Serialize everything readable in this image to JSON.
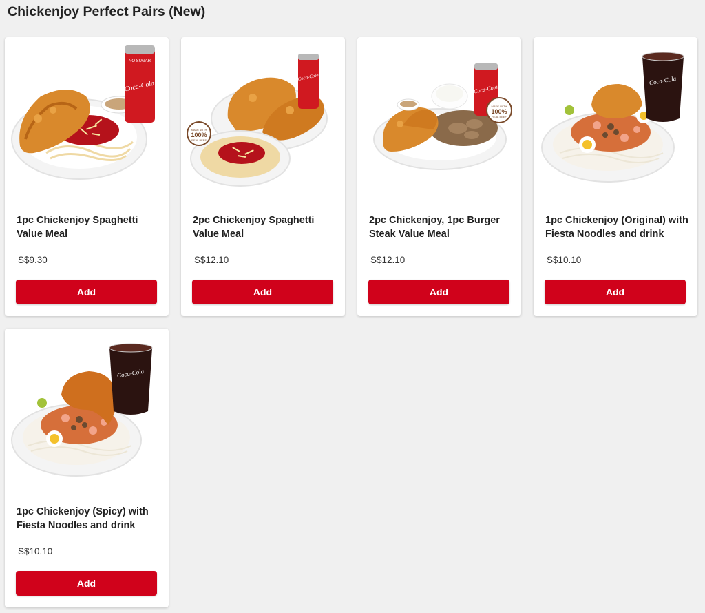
{
  "section": {
    "title": "Chickenjoy Perfect Pairs (New)"
  },
  "products": [
    {
      "name": "1pc Chickenjoy Spaghetti Value Meal",
      "price": "S$9.30",
      "add_label": "Add",
      "image": "chicken-spaghetti-coke",
      "badge": ""
    },
    {
      "name": "2pc Chickenjoy Spaghetti Value Meal",
      "price": "S$12.10",
      "add_label": "Add",
      "image": "two-chicken-spaghetti-coke",
      "badge": "MADE WITH 100% REAL BEEF"
    },
    {
      "name": "2pc Chickenjoy, 1pc Burger Steak Value Meal",
      "price": "S$12.10",
      "add_label": "Add",
      "image": "chicken-burger-steak-coke",
      "badge": "MADE WITH 100% REAL BEEF"
    },
    {
      "name": "1pc Chickenjoy (Original) with Fiesta Noodles and drink",
      "price": "S$10.10",
      "add_label": "Add",
      "image": "chicken-noodles-coke-glass",
      "badge": ""
    },
    {
      "name": "1pc Chickenjoy (Spicy) with Fiesta Noodles and drink",
      "price": "S$10.10",
      "add_label": "Add",
      "image": "spicy-chicken-noodles-coke-glass",
      "badge": ""
    }
  ],
  "colors": {
    "accent": "#d0021b",
    "background": "#f0f0f0",
    "card": "#ffffff"
  },
  "drink_labels": {
    "can_top": "NO SUGAR",
    "brand": "Coca-Cola"
  }
}
